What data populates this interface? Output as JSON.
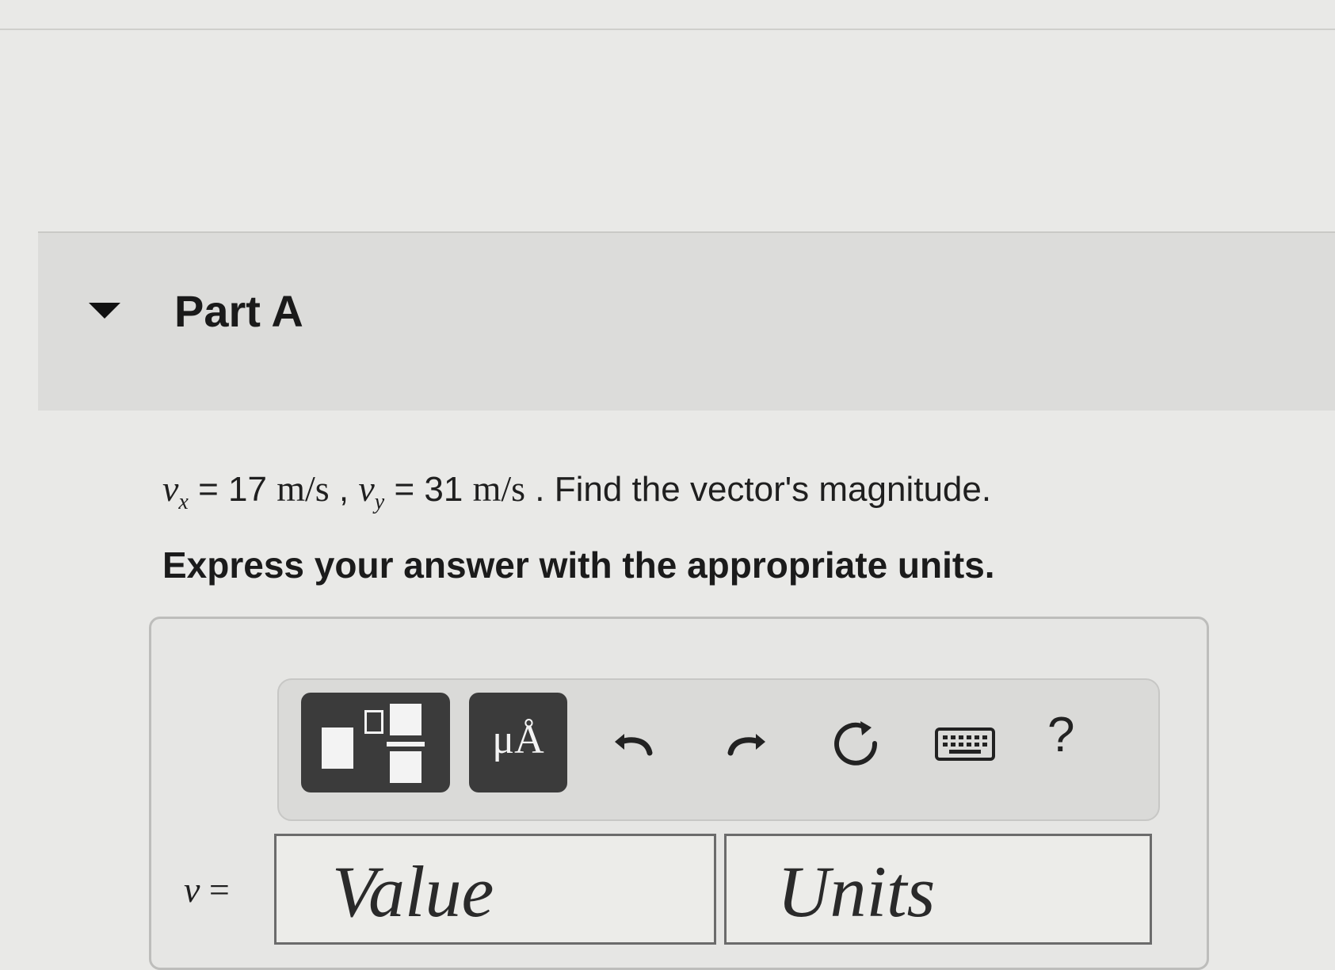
{
  "part": {
    "title": "Part A"
  },
  "question": {
    "vx_symbol": "v",
    "vx_sub": "x",
    "vx_value": "17",
    "vx_unit": "m/s",
    "sep": ",",
    "vy_symbol": "v",
    "vy_sub": "y",
    "vy_value": "31",
    "vy_unit": "m/s",
    "prompt": ". Find the vector's magnitude."
  },
  "instruction": "Express your answer with the appropriate units.",
  "toolbar": {
    "templates_icon": "templates-icon",
    "units_label": "μÅ",
    "undo_icon": "undo-icon",
    "redo_icon": "redo-icon",
    "reset_icon": "reset-icon",
    "keyboard_icon": "keyboard-icon",
    "help_label": "?"
  },
  "answer": {
    "symbol": "v",
    "equals": "=",
    "value_placeholder": "Value",
    "units_placeholder": "Units"
  }
}
